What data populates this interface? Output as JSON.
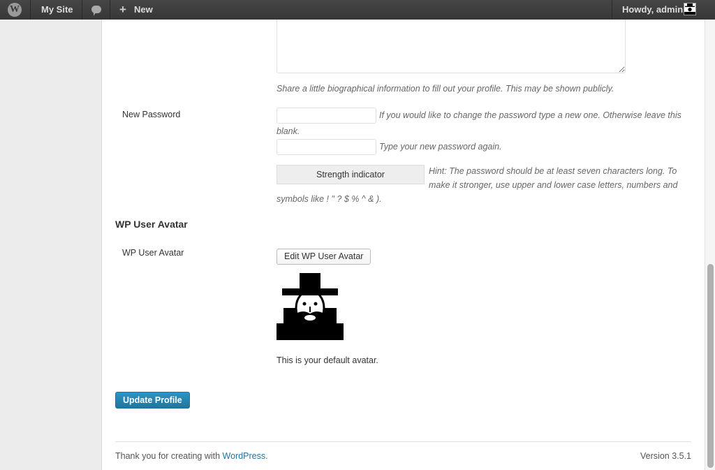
{
  "adminbar": {
    "logo_glyph": "W",
    "site_name": "My Site",
    "new_plus": "+",
    "new_label": "New",
    "howdy": "Howdy, admin"
  },
  "form": {
    "bio_description": "Share a little biographical information to fill out your profile. This may be shown publicly.",
    "new_password_label": "New Password",
    "new_password_hint_line1": "If you would like to change the password type a new one. Otherwise leave this",
    "new_password_hint_line2": "blank.",
    "repeat_password_hint": "Type your new password again.",
    "strength_indicator": "Strength indicator",
    "strength_hint_line1": "Hint: The password should be at least seven characters long. To",
    "strength_hint_line2": "make it stronger, use upper and lower case letters, numbers and",
    "strength_hint_line3": "symbols like ! \" ? $ % ^ & ).",
    "avatar_section_title": "WP User Avatar",
    "avatar_label": "WP User Avatar",
    "edit_avatar_button": "Edit WP User Avatar",
    "default_avatar_text": "This is your default avatar.",
    "update_button": "Update Profile"
  },
  "footer": {
    "thanks_prefix": "Thank you for creating with ",
    "wordpress_link": "WordPress",
    "thanks_suffix": ".",
    "version": "Version 3.5.1"
  },
  "colors": {
    "adminbar_bg": "#464646",
    "primary_button": "#21759b",
    "link": "#21759b"
  }
}
